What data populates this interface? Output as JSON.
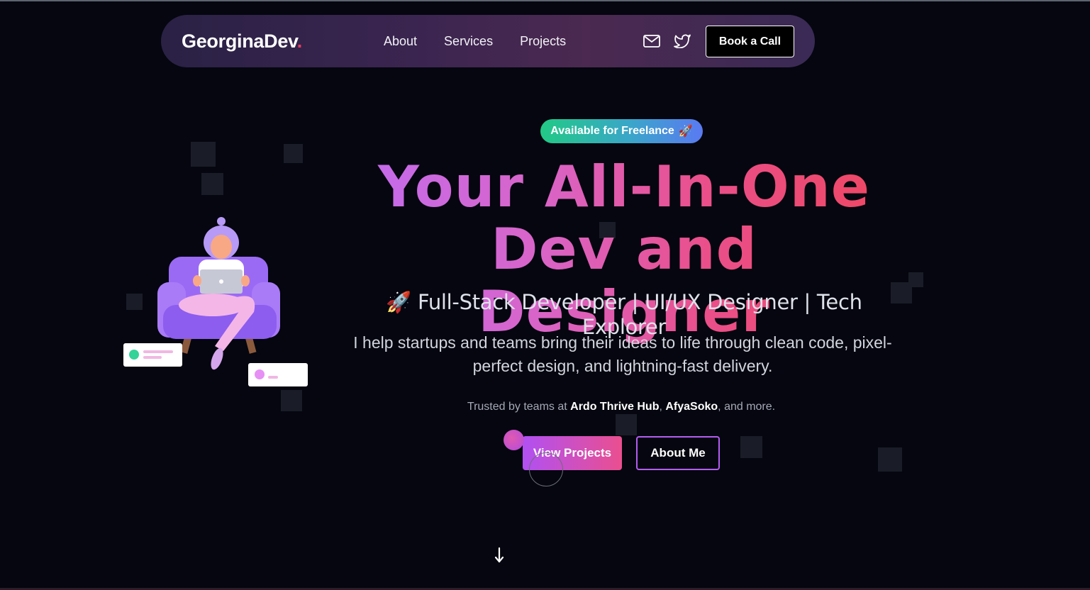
{
  "nav": {
    "logo_text": "GeorginaDev",
    "logo_dot": ".",
    "links": [
      "About",
      "Services",
      "Projects"
    ],
    "cta_label": "Book a Call",
    "icons": [
      "mail-icon",
      "twitter-icon"
    ]
  },
  "hero": {
    "badge": "Available for Freelance",
    "badge_emoji": "🚀",
    "headline_line1": "Your All-In-One",
    "headline_line2": "Dev and Designer",
    "subtitle_emoji": "🚀",
    "subtitle": "Full-Stack Developer | UI/UX Designer | Tech Explorer",
    "description": "I help startups and teams bring their ideas to life through clean code, pixel-perfect design, and lightning-fast delivery.",
    "trusted_prefix": "Trusted by teams at ",
    "trusted_company1": "Ardo Thrive Hub",
    "trusted_separator": ", ",
    "trusted_company2": "AfyaSoko",
    "trusted_suffix": ", and more.",
    "primary_button": "View Projects",
    "secondary_button": "About Me",
    "scroll_icon": "arrow-down-icon"
  },
  "colors": {
    "background": "#05060f",
    "accent_pink": "#ec3b5e",
    "accent_purple": "#b150f3",
    "badge_green": "#22c986",
    "badge_blue": "#5a7af2"
  }
}
